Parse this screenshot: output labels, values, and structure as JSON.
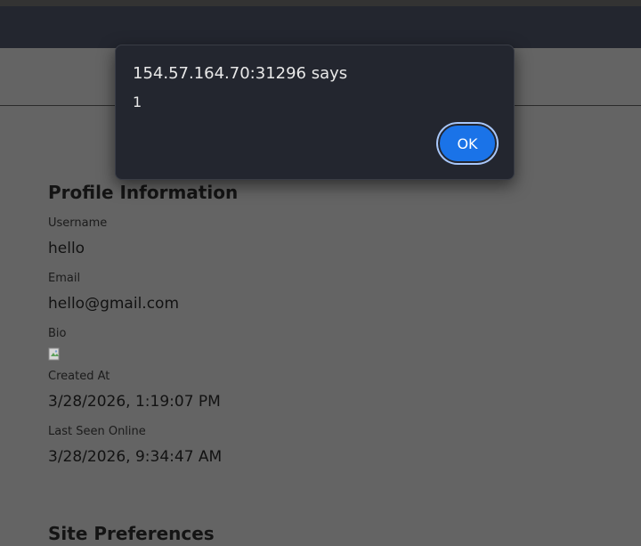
{
  "profile": {
    "title": "Profile Information",
    "fields": [
      {
        "label": "Username",
        "value": "hello"
      },
      {
        "label": "Email",
        "value": "hello@gmail.com"
      },
      {
        "label": "Bio"
      },
      {
        "label": "Created At",
        "value": "3/28/2026, 1:19:07 PM"
      },
      {
        "label": "Last Seen Online",
        "value": "3/28/2026, 9:34:47 AM"
      }
    ]
  },
  "next_section": {
    "title": "Site Preferences"
  },
  "dialog": {
    "title": "154.57.164.70:31296 says",
    "message": "1",
    "ok_label": "OK"
  },
  "icons": {
    "bio_image": "broken-image-icon"
  },
  "colors": {
    "dialog_bg": "#23262f",
    "ok_button": "#1a73e8",
    "page_overlay": "#646464"
  }
}
